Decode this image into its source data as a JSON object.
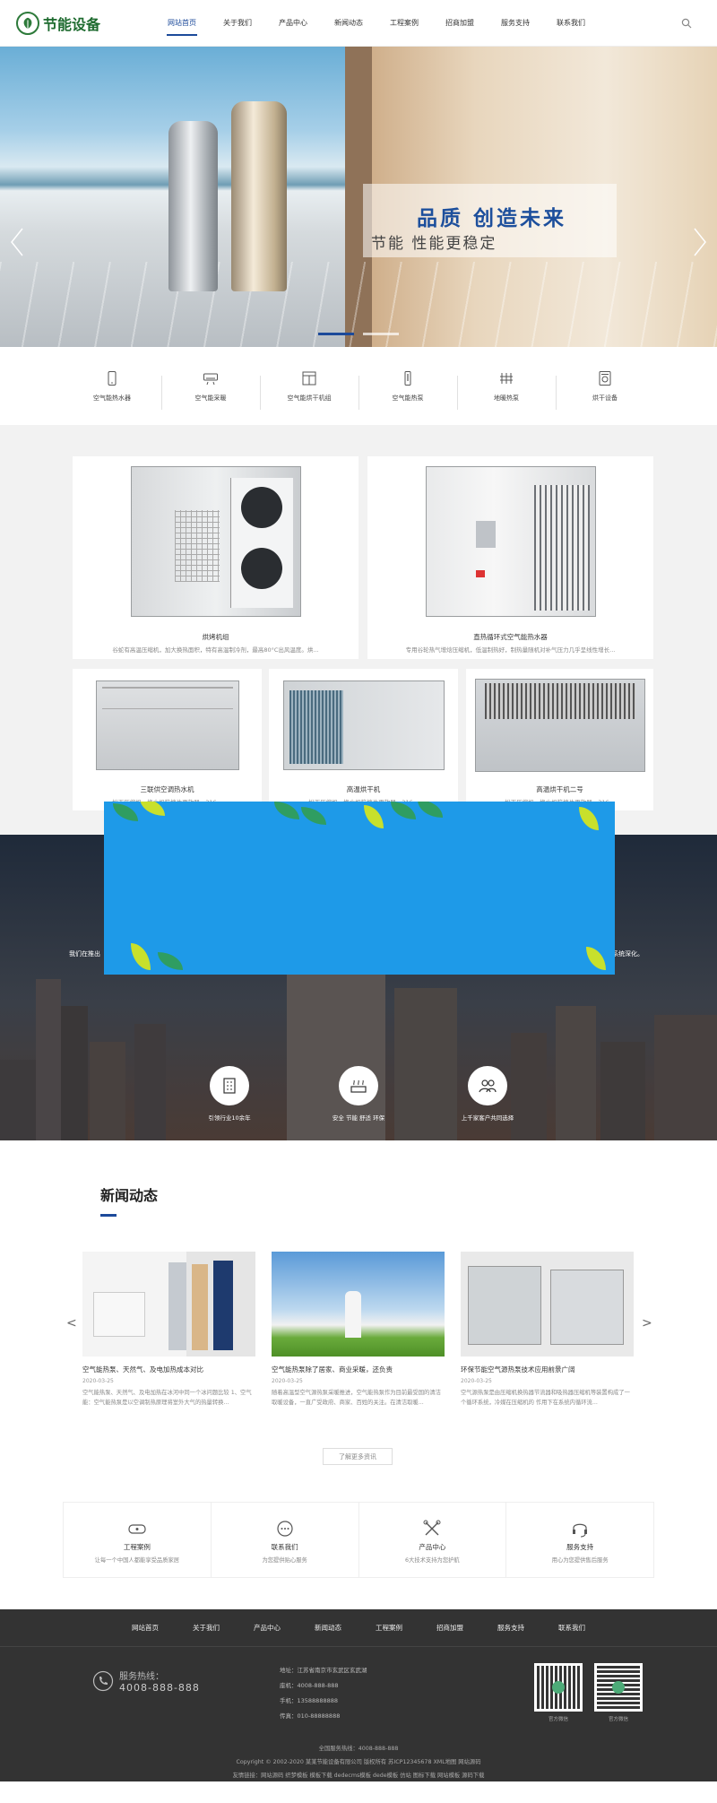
{
  "header": {
    "logo_text": "节能设备",
    "nav": [
      "网站首页",
      "关于我们",
      "产品中心",
      "新闻动态",
      "工程案例",
      "招商加盟",
      "服务支持",
      "联系我们"
    ]
  },
  "banner": {
    "title": "品质  创造未来",
    "subtitle": "节能 性能更稳定"
  },
  "categories": [
    "空气能热水器",
    "空气能采暖",
    "空气能烘干机组",
    "空气能热泵",
    "地暖热泵",
    "烘干设备"
  ],
  "products": [
    {
      "name": "烘烤机组",
      "desc": "谷蛇有高温压缩机，加大换热面积，特有高温制冷剂，最高80°C出风温度。烘..."
    },
    {
      "name": "直热循环式空气能热水器",
      "desc": "专用谷轮热气增焓压缩机，低温制热好，制热量随机对补气压力几乎呈线性增长..."
    },
    {
      "name": "三联供空调热水机",
      "desc": "松下压缩机，换水机箱搪片更放器。316..."
    },
    {
      "name": "高温烘干机",
      "desc": "松下压缩机，换水机箱搪片更放器。316..."
    },
    {
      "name": "高温烘干机二号",
      "desc": "松下压缩机，换水机箱搪片更放器。316..."
    }
  ],
  "city": {
    "text_left": "我们在推出",
    "text_right": "系统深化。",
    "features": [
      "引领行业10余年",
      "安全 节能 舒适 环保",
      "上千家客户共同选择"
    ]
  },
  "news": {
    "title": "新闻动态",
    "items": [
      {
        "title": "空气能热泵、天然气、及电加热成本对比",
        "date": "2020-03-25",
        "desc": "空气能热泵、天然气、及电加热在冰河中同一个冰问题比较 1、空气能：空气能热泵是以空调制热原理将室外大气的热量转换..."
      },
      {
        "title": "空气能热泵除了居家、商业采暖，还负责",
        "date": "2020-03-25",
        "desc": "随着高温型空气源热泵采暖推进，空气能热泵作为目前最受国的清洁取暖设备，一直广受政府、商家、百姓的关注。在清洁取暖..."
      },
      {
        "title": "环保节能空气源热泵技术应用前景广阔",
        "date": "2020-03-25",
        "desc": "空气源热泵是由压缩机换热器节流器和吸热器压缩机等装置构成了一个循环系统，冷媒在压缩机的 作用下在系统内循环流..."
      }
    ],
    "more": "了解更多资讯"
  },
  "services": [
    {
      "title": "工程案例",
      "desc": "让每一个中国人都能享受品质家居"
    },
    {
      "title": "联系我们",
      "desc": "为您提供贴心服务"
    },
    {
      "title": "产品中心",
      "desc": "6大技术支持为您护航"
    },
    {
      "title": "服务支持",
      "desc": "用心为您提供售后服务"
    }
  ],
  "footer": {
    "nav": [
      "网站首页",
      "关于我们",
      "产品中心",
      "新闻动态",
      "工程案例",
      "招商加盟",
      "服务支持",
      "联系我们"
    ],
    "hotline_label": "服务热线：",
    "hotline_number": "4008-888-888",
    "address": "地址：江苏省南京市玄武区玄武湖",
    "phone": "座机：4008-888-888",
    "mobile": "手机：13588888888",
    "fax": "传真：010-88888888",
    "qr_captions": [
      "官方微信",
      "官方微信"
    ],
    "national_hotline": "全国服务热线：4008-888-888",
    "copyright": "Copyright © 2002-2020 某某节能设备有限公司 版权所有 苏ICP12345678 XML地图 网站源码",
    "friend_links": "友情链接：网站源码    织梦模板    模板下载    dedecms模板    dede模板    仿站    图标下载    网站模板    源码下载"
  }
}
